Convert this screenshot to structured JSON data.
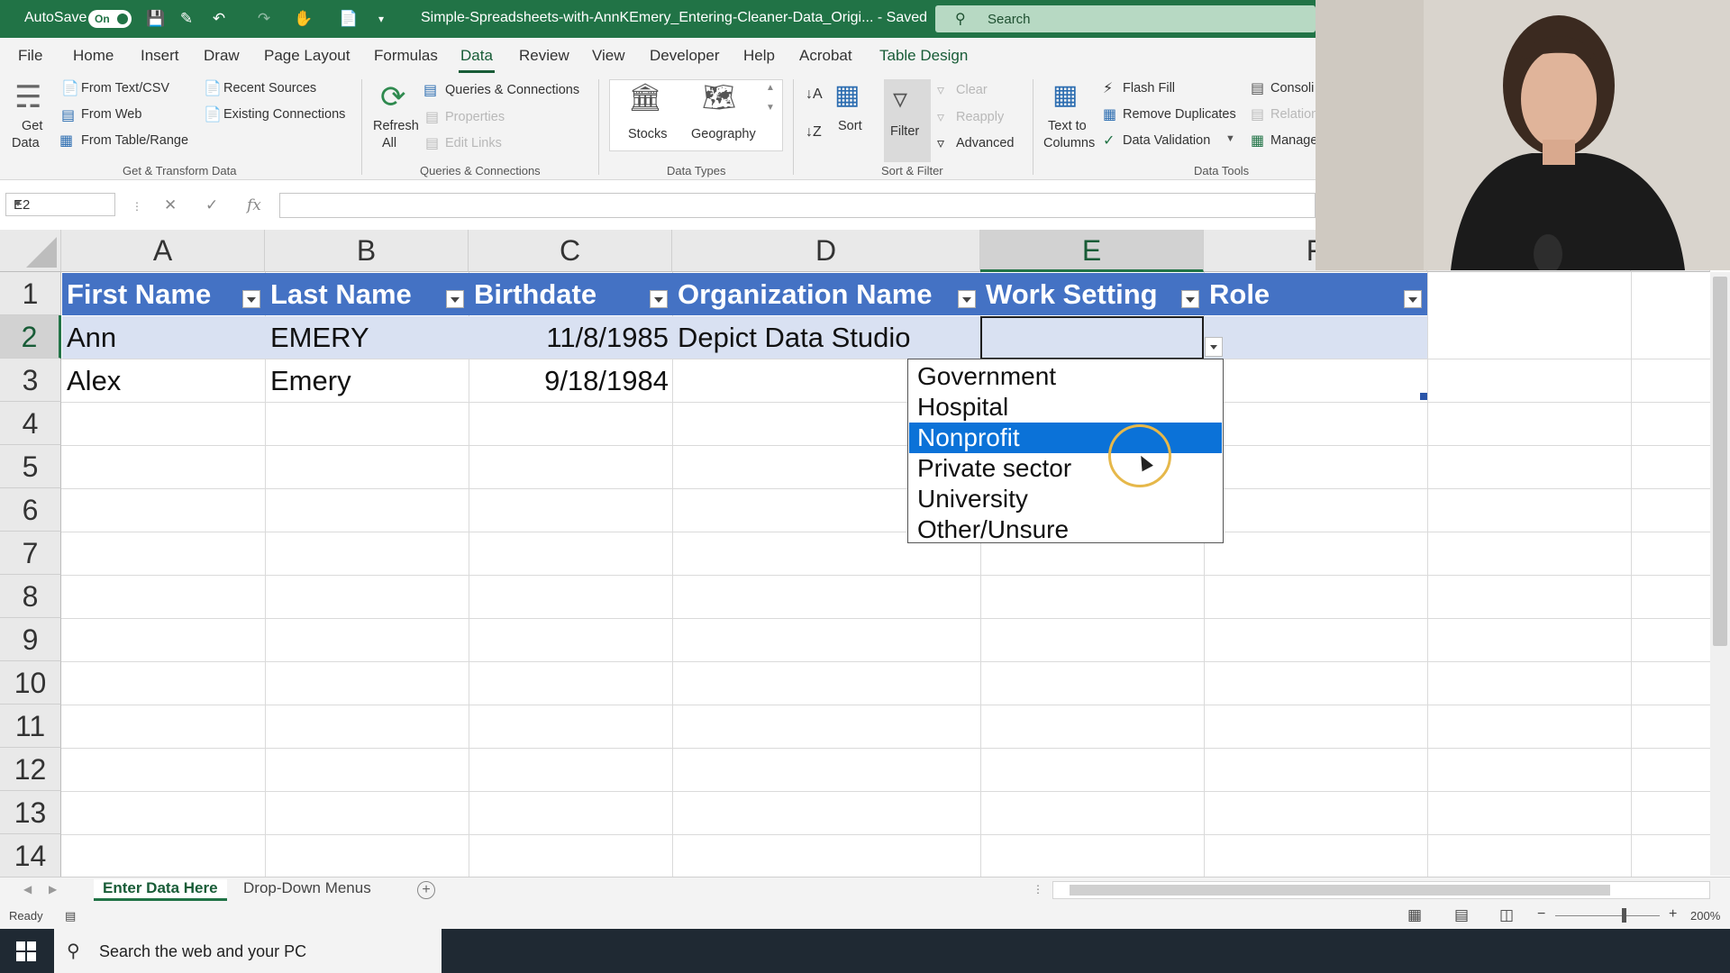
{
  "titlebar": {
    "autosave_label": "AutoSave",
    "autosave_state": "On",
    "doc_title": "Simple-Spreadsheets-with-AnnKEmery_Entering-Cleaner-Data_Origi... - Saved",
    "search_placeholder": "Search"
  },
  "menu": {
    "tabs": [
      "File",
      "Home",
      "Insert",
      "Draw",
      "Page Layout",
      "Formulas",
      "Data",
      "Review",
      "View",
      "Developer",
      "Help",
      "Acrobat",
      "Table Design"
    ],
    "active_tab": "Data"
  },
  "ribbon": {
    "get_data": "Get",
    "get_data2": "Data",
    "from_text": "From Text/CSV",
    "from_web": "From Web",
    "from_table": "From Table/Range",
    "recent_sources": "Recent Sources",
    "existing_connections": "Existing Connections",
    "group_get_transform": "Get & Transform Data",
    "refresh": "Refresh",
    "refresh2": "All",
    "queries_connections": "Queries & Connections",
    "properties": "Properties",
    "edit_links": "Edit Links",
    "group_queries": "Queries & Connections",
    "stocks": "Stocks",
    "geography": "Geography",
    "group_datatypes": "Data Types",
    "sort": "Sort",
    "filter": "Filter",
    "clear": "Clear",
    "reapply": "Reapply",
    "advanced": "Advanced",
    "group_sortfilter": "Sort & Filter",
    "text_to": "Text to",
    "columns": "Columns",
    "flash_fill": "Flash Fill",
    "remove_duplicates": "Remove Duplicates",
    "data_validation": "Data Validation",
    "consolidate": "Consoli",
    "relationships": "Relation",
    "manage": "Manage",
    "group_datatools": "Data Tools"
  },
  "formula_bar": {
    "name_box": "E2",
    "fx": "fx",
    "content": ""
  },
  "grid": {
    "columns": [
      "A",
      "B",
      "C",
      "D",
      "E",
      "F"
    ],
    "rows": [
      "1",
      "2",
      "3",
      "4",
      "5",
      "6",
      "7",
      "8",
      "9",
      "10",
      "11",
      "12",
      "13",
      "14"
    ],
    "headers": [
      "First Name",
      "Last Name",
      "Birthdate",
      "Organization Name",
      "Work Setting",
      "Role"
    ],
    "data": [
      [
        "Ann",
        "EMERY",
        "11/8/1985",
        "Depict Data Studio",
        "",
        ""
      ],
      [
        "Alex",
        "Emery",
        "9/18/1984",
        "",
        "",
        ""
      ]
    ],
    "selected_cell": "E2",
    "table_header_color": "#4472c4",
    "table_band_color": "#d9e1f2"
  },
  "dropdown": {
    "options": [
      "Government",
      "Hospital",
      "Nonprofit",
      "Private sector",
      "University",
      "Other/Unsure"
    ],
    "highlighted": "Nonprofit",
    "highlight_color": "#0b72d8"
  },
  "sheets": {
    "tabs": [
      "Enter Data Here",
      "Drop-Down Menus"
    ],
    "active": "Enter Data Here"
  },
  "status": {
    "ready": "Ready",
    "zoom": "200%"
  },
  "taskbar": {
    "search_placeholder": "Search the web and your PC"
  },
  "accent_color": "#217346"
}
